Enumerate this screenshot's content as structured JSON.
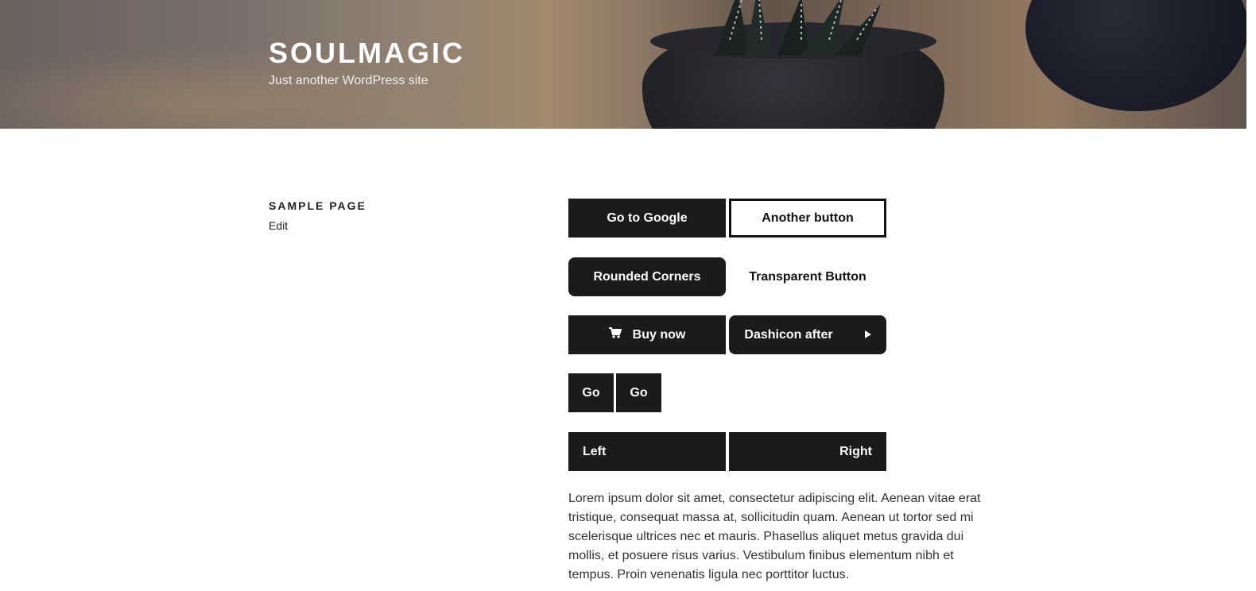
{
  "site": {
    "title": "SOULMAGIC",
    "description": "Just another WordPress site"
  },
  "page": {
    "title": "SAMPLE PAGE",
    "edit_label": "Edit"
  },
  "buttons": {
    "go_to_google": "Go to Google",
    "another_button": "Another button",
    "rounded_corners": "Rounded Corners",
    "transparent_button": "Transparent Button",
    "buy_now": "Buy now",
    "dashicon_after": "Dashicon after",
    "go_1": "Go",
    "go_2": "Go",
    "left": "Left",
    "right": "Right"
  },
  "icons": {
    "cart": "cart-icon",
    "arrow_right": "caret-right-icon"
  },
  "content": {
    "paragraph": "Lorem ipsum dolor sit amet, consectetur adipiscing elit. Aenean vitae erat tristique, consequat massa at, sollicitudin quam. Aenean ut tortor sed mi scelerisque ultrices nec et mauris. Phasellus aliquet metus gravida dui mollis, et posuere risus varius. Vestibulum finibus elementum nibh et tempus. Proin venenatis ligula nec porttitor luctus."
  },
  "colors": {
    "button_bg": "#1b1b1b",
    "button_text": "#ffffff",
    "text": "#222222"
  }
}
